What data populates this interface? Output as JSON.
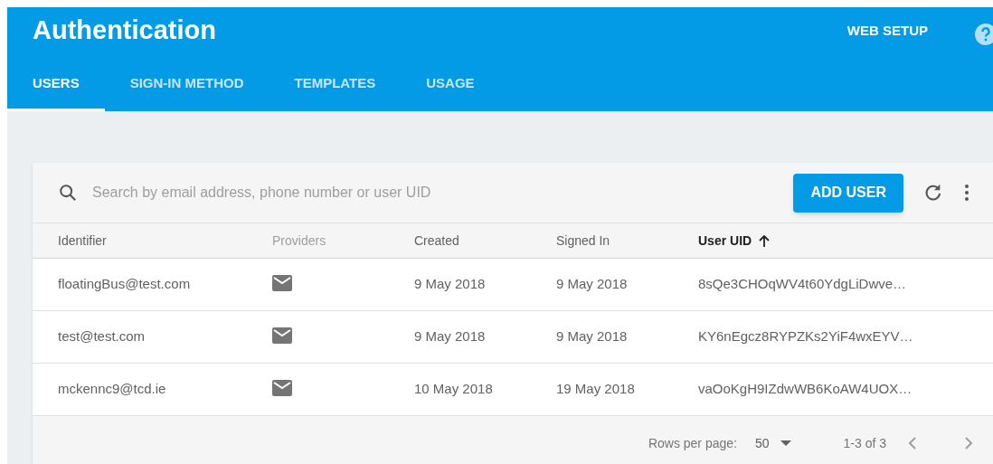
{
  "header": {
    "title": "Authentication",
    "action": "WEB SETUP"
  },
  "tabs": [
    {
      "label": "USERS",
      "selected": true
    },
    {
      "label": "SIGN-IN METHOD",
      "selected": false
    },
    {
      "label": "TEMPLATES",
      "selected": false
    },
    {
      "label": "USAGE",
      "selected": false
    }
  ],
  "search": {
    "placeholder": "Search by email address, phone number or user UID"
  },
  "add_button": "ADD USER",
  "table": {
    "columns": [
      {
        "label": "Identifier",
        "sortable": true,
        "sorted": false
      },
      {
        "label": "Providers",
        "sortable": false,
        "sorted": false
      },
      {
        "label": "Created",
        "sortable": true,
        "sorted": false
      },
      {
        "label": "Signed In",
        "sortable": true,
        "sorted": false
      },
      {
        "label": "User UID",
        "sortable": true,
        "sorted": true
      }
    ],
    "rows": [
      {
        "identifier": "floatingBus@test.com",
        "kind": "email",
        "created": "9 May 2018",
        "signed_in": "9 May 2018",
        "uid": "8sQe3CHOqWV4t60YdgLiDwve…"
      },
      {
        "identifier": "test@test.com",
        "kind": "email",
        "created": "9 May 2018",
        "signed_in": "9 May 2018",
        "uid": "KY6nEgcz8RYPZKs2YiF4wxEYV…"
      },
      {
        "identifier": "mckennc9@tcd.ie",
        "kind": "email",
        "created": "10 May 2018",
        "signed_in": "19 May 2018",
        "uid": "vaOoKgH9IZdwWB6KoAW4UOX…"
      }
    ]
  },
  "pagination": {
    "rows_label": "Rows per page:",
    "rows_value": "50",
    "range": "1-3 of 3"
  }
}
